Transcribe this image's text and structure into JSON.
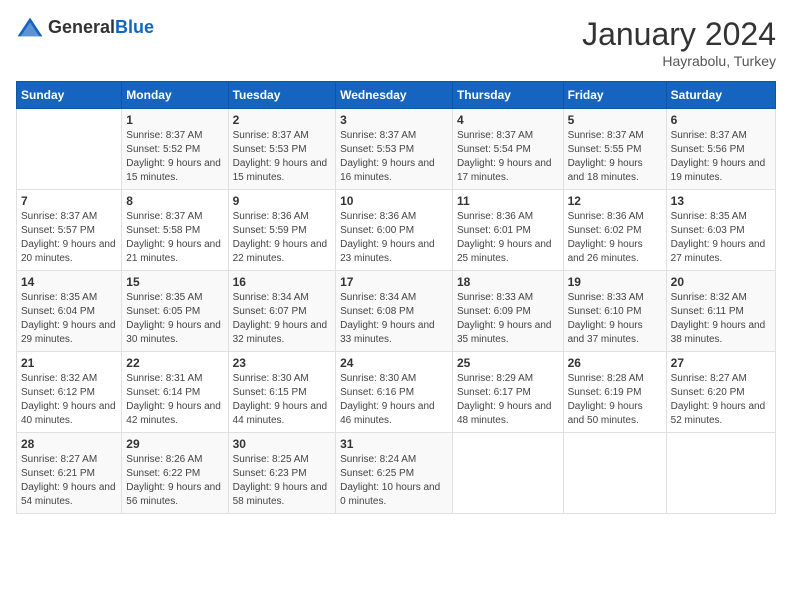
{
  "header": {
    "logo_general": "General",
    "logo_blue": "Blue",
    "month": "January 2024",
    "location": "Hayrabolu, Turkey"
  },
  "weekdays": [
    "Sunday",
    "Monday",
    "Tuesday",
    "Wednesday",
    "Thursday",
    "Friday",
    "Saturday"
  ],
  "weeks": [
    [
      {
        "day": "",
        "sunrise": "",
        "sunset": "",
        "daylight": ""
      },
      {
        "day": "1",
        "sunrise": "Sunrise: 8:37 AM",
        "sunset": "Sunset: 5:52 PM",
        "daylight": "Daylight: 9 hours and 15 minutes."
      },
      {
        "day": "2",
        "sunrise": "Sunrise: 8:37 AM",
        "sunset": "Sunset: 5:53 PM",
        "daylight": "Daylight: 9 hours and 15 minutes."
      },
      {
        "day": "3",
        "sunrise": "Sunrise: 8:37 AM",
        "sunset": "Sunset: 5:53 PM",
        "daylight": "Daylight: 9 hours and 16 minutes."
      },
      {
        "day": "4",
        "sunrise": "Sunrise: 8:37 AM",
        "sunset": "Sunset: 5:54 PM",
        "daylight": "Daylight: 9 hours and 17 minutes."
      },
      {
        "day": "5",
        "sunrise": "Sunrise: 8:37 AM",
        "sunset": "Sunset: 5:55 PM",
        "daylight": "Daylight: 9 hours and 18 minutes."
      },
      {
        "day": "6",
        "sunrise": "Sunrise: 8:37 AM",
        "sunset": "Sunset: 5:56 PM",
        "daylight": "Daylight: 9 hours and 19 minutes."
      }
    ],
    [
      {
        "day": "7",
        "sunrise": "Sunrise: 8:37 AM",
        "sunset": "Sunset: 5:57 PM",
        "daylight": "Daylight: 9 hours and 20 minutes."
      },
      {
        "day": "8",
        "sunrise": "Sunrise: 8:37 AM",
        "sunset": "Sunset: 5:58 PM",
        "daylight": "Daylight: 9 hours and 21 minutes."
      },
      {
        "day": "9",
        "sunrise": "Sunrise: 8:36 AM",
        "sunset": "Sunset: 5:59 PM",
        "daylight": "Daylight: 9 hours and 22 minutes."
      },
      {
        "day": "10",
        "sunrise": "Sunrise: 8:36 AM",
        "sunset": "Sunset: 6:00 PM",
        "daylight": "Daylight: 9 hours and 23 minutes."
      },
      {
        "day": "11",
        "sunrise": "Sunrise: 8:36 AM",
        "sunset": "Sunset: 6:01 PM",
        "daylight": "Daylight: 9 hours and 25 minutes."
      },
      {
        "day": "12",
        "sunrise": "Sunrise: 8:36 AM",
        "sunset": "Sunset: 6:02 PM",
        "daylight": "Daylight: 9 hours and 26 minutes."
      },
      {
        "day": "13",
        "sunrise": "Sunrise: 8:35 AM",
        "sunset": "Sunset: 6:03 PM",
        "daylight": "Daylight: 9 hours and 27 minutes."
      }
    ],
    [
      {
        "day": "14",
        "sunrise": "Sunrise: 8:35 AM",
        "sunset": "Sunset: 6:04 PM",
        "daylight": "Daylight: 9 hours and 29 minutes."
      },
      {
        "day": "15",
        "sunrise": "Sunrise: 8:35 AM",
        "sunset": "Sunset: 6:05 PM",
        "daylight": "Daylight: 9 hours and 30 minutes."
      },
      {
        "day": "16",
        "sunrise": "Sunrise: 8:34 AM",
        "sunset": "Sunset: 6:07 PM",
        "daylight": "Daylight: 9 hours and 32 minutes."
      },
      {
        "day": "17",
        "sunrise": "Sunrise: 8:34 AM",
        "sunset": "Sunset: 6:08 PM",
        "daylight": "Daylight: 9 hours and 33 minutes."
      },
      {
        "day": "18",
        "sunrise": "Sunrise: 8:33 AM",
        "sunset": "Sunset: 6:09 PM",
        "daylight": "Daylight: 9 hours and 35 minutes."
      },
      {
        "day": "19",
        "sunrise": "Sunrise: 8:33 AM",
        "sunset": "Sunset: 6:10 PM",
        "daylight": "Daylight: 9 hours and 37 minutes."
      },
      {
        "day": "20",
        "sunrise": "Sunrise: 8:32 AM",
        "sunset": "Sunset: 6:11 PM",
        "daylight": "Daylight: 9 hours and 38 minutes."
      }
    ],
    [
      {
        "day": "21",
        "sunrise": "Sunrise: 8:32 AM",
        "sunset": "Sunset: 6:12 PM",
        "daylight": "Daylight: 9 hours and 40 minutes."
      },
      {
        "day": "22",
        "sunrise": "Sunrise: 8:31 AM",
        "sunset": "Sunset: 6:14 PM",
        "daylight": "Daylight: 9 hours and 42 minutes."
      },
      {
        "day": "23",
        "sunrise": "Sunrise: 8:30 AM",
        "sunset": "Sunset: 6:15 PM",
        "daylight": "Daylight: 9 hours and 44 minutes."
      },
      {
        "day": "24",
        "sunrise": "Sunrise: 8:30 AM",
        "sunset": "Sunset: 6:16 PM",
        "daylight": "Daylight: 9 hours and 46 minutes."
      },
      {
        "day": "25",
        "sunrise": "Sunrise: 8:29 AM",
        "sunset": "Sunset: 6:17 PM",
        "daylight": "Daylight: 9 hours and 48 minutes."
      },
      {
        "day": "26",
        "sunrise": "Sunrise: 8:28 AM",
        "sunset": "Sunset: 6:19 PM",
        "daylight": "Daylight: 9 hours and 50 minutes."
      },
      {
        "day": "27",
        "sunrise": "Sunrise: 8:27 AM",
        "sunset": "Sunset: 6:20 PM",
        "daylight": "Daylight: 9 hours and 52 minutes."
      }
    ],
    [
      {
        "day": "28",
        "sunrise": "Sunrise: 8:27 AM",
        "sunset": "Sunset: 6:21 PM",
        "daylight": "Daylight: 9 hours and 54 minutes."
      },
      {
        "day": "29",
        "sunrise": "Sunrise: 8:26 AM",
        "sunset": "Sunset: 6:22 PM",
        "daylight": "Daylight: 9 hours and 56 minutes."
      },
      {
        "day": "30",
        "sunrise": "Sunrise: 8:25 AM",
        "sunset": "Sunset: 6:23 PM",
        "daylight": "Daylight: 9 hours and 58 minutes."
      },
      {
        "day": "31",
        "sunrise": "Sunrise: 8:24 AM",
        "sunset": "Sunset: 6:25 PM",
        "daylight": "Daylight: 10 hours and 0 minutes."
      },
      {
        "day": "",
        "sunrise": "",
        "sunset": "",
        "daylight": ""
      },
      {
        "day": "",
        "sunrise": "",
        "sunset": "",
        "daylight": ""
      },
      {
        "day": "",
        "sunrise": "",
        "sunset": "",
        "daylight": ""
      }
    ]
  ]
}
